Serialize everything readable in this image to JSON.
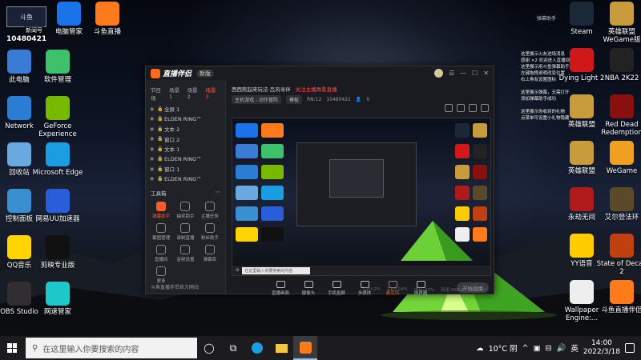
{
  "overlay": {
    "logo_text": "斗鱼",
    "badge": "新闻号",
    "id": "10480421"
  },
  "desktop_left": [
    {
      "label": "电脑管家",
      "icon": "pc-manager-icon",
      "color": "#1a73e8"
    },
    {
      "label": "斗鱼直播",
      "icon": "douyu-icon",
      "color": "#ff7a1a"
    },
    {
      "label": "此电脑",
      "icon": "this-pc-icon",
      "color": "#3a7bd5"
    },
    {
      "label": "软件管理",
      "icon": "software-manager-icon",
      "color": "#3fc06a"
    },
    {
      "label": "Network",
      "icon": "network-icon",
      "color": "#2b7cd3"
    },
    {
      "label": "GeForce Experience",
      "icon": "geforce-icon",
      "color": "#76b900"
    },
    {
      "label": "回收站",
      "icon": "recycle-bin-icon",
      "color": "#6aa9e0"
    },
    {
      "label": "Microsoft Edge",
      "icon": "edge-icon",
      "color": "#1b9de2"
    },
    {
      "label": "控制面板",
      "icon": "control-panel-icon",
      "color": "#3a8fd0"
    },
    {
      "label": "网易UU加速器",
      "icon": "uu-accelerator-icon",
      "color": "#2a5dd8"
    },
    {
      "label": "QQ音乐",
      "icon": "qq-music-icon",
      "color": "#ffd400"
    },
    {
      "label": "剪映专业版",
      "icon": "jianying-icon",
      "color": "#111111"
    },
    {
      "label": "OBS Studio",
      "icon": "obs-icon",
      "color": "#302e31"
    },
    {
      "label": "网速管家",
      "icon": "netspeed-icon",
      "color": "#1ec8c8"
    }
  ],
  "desktop_right": [
    {
      "label": "Steam",
      "icon": "steam-icon",
      "color": "#1b2838"
    },
    {
      "label": "英雄联盟 WeGame版",
      "icon": "lol-wegame-icon",
      "color": "#c89b3c"
    },
    {
      "label": "Dying Light 2",
      "icon": "dying-light-icon",
      "color": "#d01818"
    },
    {
      "label": "NBA 2K22",
      "icon": "nba2k22-icon",
      "color": "#222222"
    },
    {
      "label": "英雄联盟",
      "icon": "lol-icon",
      "color": "#c89b3c"
    },
    {
      "label": "Red Dead Redemption",
      "icon": "rdr-icon",
      "color": "#8a1010"
    },
    {
      "label": "英雄联盟",
      "icon": "lol-icon-2",
      "color": "#c89b3c"
    },
    {
      "label": "WeGame",
      "icon": "wegame-icon",
      "color": "#f0a020"
    },
    {
      "label": "永劫无间",
      "icon": "naraka-icon",
      "color": "#b01a1a"
    },
    {
      "label": "艾尔登法环",
      "icon": "elden-ring-icon",
      "color": "#5a4a2a"
    },
    {
      "label": "YY语音",
      "icon": "yy-icon",
      "color": "#ffcc00"
    },
    {
      "label": "State of Decay 2",
      "icon": "state-of-decay-icon",
      "color": "#c04010"
    },
    {
      "label": "Wallpaper Engine:...",
      "icon": "wallpaper-engine-icon",
      "color": "#eeeeee"
    },
    {
      "label": "斗鱼直播伴侣",
      "icon": "douyu-companion-icon",
      "color": "#ff7a1a"
    }
  ],
  "chat": {
    "title": "弹幕助手",
    "lines": [
      "这里展示火友进场消息",
      "感谢 ×2  欢迎进入直播间",
      "这里展示用斗鱼弹幕助手",
      "左键拖拽说明改变位置",
      "右上角有设置图标",
      "这里展示弹幕，无需打开",
      "添加弹幕助手成功",
      "这里展示你收到的礼物",
      "点菜单可设置小礼物隐藏"
    ]
  },
  "app": {
    "logo": "直播伴侣",
    "version": "新版",
    "scene_tabs": [
      "节目场",
      "场景 1",
      "场景 2",
      "场景 3"
    ],
    "sources": [
      "全屏 1",
      "ELDEN RING™",
      "文本 2",
      "窗口 2",
      "文本 1",
      "ELDEN RING™",
      "窗口 1",
      "ELDEN RING™"
    ],
    "tools_title": "工具箱",
    "tools": [
      "弹幕助手",
      "抽奖助手",
      "主播任务",
      "截图管理",
      "录制直播",
      "粉丝助手",
      "直播间",
      "音频设置",
      "弹幕库",
      "更多"
    ],
    "left_footer": "斗鱼直播伴侣官方网站",
    "room_title": "西西爬起来玩法·吕风寻伴",
    "room_link": "关注主播再看直播",
    "category_chip": "主机游戏 - 动作冒险",
    "chip2": "模板",
    "room_no": "RN:12",
    "room_id": "10480421",
    "viewers": "0",
    "controls": [
      "直播画面",
      "摄像头",
      "手机投屏",
      "多媒体",
      "麦克风",
      "扬声器"
    ],
    "start_live": "开始直播",
    "status": [
      "CPU:2%",
      "GPU:24%",
      "内存:43%",
      "网速:0KB/s",
      "丢帧:0%"
    ]
  },
  "preview": {
    "search_placeholder": "在这里输入你要搜索的内容"
  },
  "taskbar": {
    "search_placeholder": "在这里输入你要搜索的内容",
    "weather": "10°C 阴",
    "ime": "英",
    "time": "14:00",
    "date": "2022/3/18"
  }
}
